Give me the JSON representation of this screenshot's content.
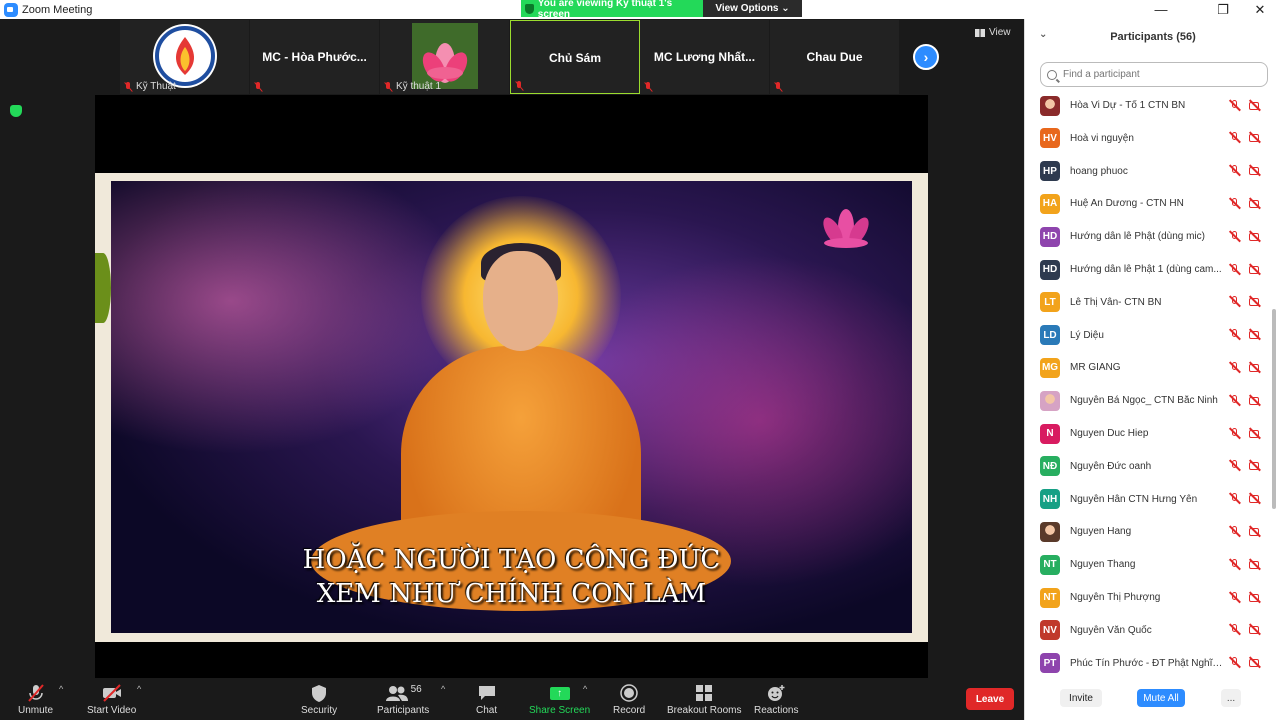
{
  "window": {
    "title": "Zoom Meeting",
    "minimize": "—",
    "maximize": "❐",
    "close": "✕"
  },
  "banner": {
    "viewing": "You are viewing Kỹ thuật 1's screen",
    "view_options": "View Options ⌄"
  },
  "view_label": "View",
  "strip": [
    {
      "name": "",
      "label": "Kỹ Thuật",
      "has_image": "logo"
    },
    {
      "name": "MC - Hòa Phước...",
      "label": ""
    },
    {
      "name": "",
      "label": "Kỹ thuật 1",
      "has_image": "lotus"
    },
    {
      "name": "Chủ Sám",
      "label": "",
      "active": true
    },
    {
      "name": "MC Lương Nhất...",
      "label": ""
    },
    {
      "name": "Chau Due",
      "label": ""
    }
  ],
  "next_arrow": "›",
  "shared_screen": {
    "caption_line1": "HOẶC NGƯỜI TẠO CÔNG ĐỨC",
    "caption_line2": "XEM NHƯ CHÍNH CON LÀM"
  },
  "toolbar": {
    "unmute": "Unmute",
    "start_video": "Start Video",
    "security": "Security",
    "participants": "Participants",
    "participants_count": "56",
    "chat": "Chat",
    "share_screen": "Share Screen",
    "record": "Record",
    "breakout_rooms": "Breakout Rooms",
    "reactions": "Reactions",
    "leave": "Leave",
    "caret": "^"
  },
  "panel": {
    "title": "Participants (56)",
    "collapse": "⌄",
    "search_placeholder": "Find a participant",
    "participants": [
      {
        "initials": "",
        "name": "Hòa Vi Dự - Tổ 1 CTN BN",
        "color": "#8a2a2a",
        "photo": true
      },
      {
        "initials": "HV",
        "name": "Hoà vi nguyện",
        "color": "#e8671c"
      },
      {
        "initials": "HP",
        "name": "hoang phuoc",
        "color": "#2e3a4f"
      },
      {
        "initials": "HA",
        "name": "Huệ An Dương - CTN HN",
        "color": "#f2a31b"
      },
      {
        "initials": "HD",
        "name": "Hướng dẫn lễ Phật (dùng mic)",
        "color": "#8e44ad"
      },
      {
        "initials": "HD",
        "name": "Hướng dẫn lễ Phật 1 (dùng cam...",
        "color": "#2e3a4f"
      },
      {
        "initials": "LT",
        "name": "Lê Thị Vân- CTN BN",
        "color": "#f2a31b"
      },
      {
        "initials": "LD",
        "name": "Lý Diệu",
        "color": "#2a7ab8"
      },
      {
        "initials": "MG",
        "name": "MR GIANG",
        "color": "#f2a31b"
      },
      {
        "initials": "",
        "name": "Nguyễn Bá Ngọc_ CTN Bắc Ninh",
        "color": "#d6a3c4",
        "photo": true
      },
      {
        "initials": "N",
        "name": "Nguyen Duc Hiep",
        "color": "#d81b60"
      },
      {
        "initials": "NĐ",
        "name": "Nguyễn Đức oanh",
        "color": "#27ae60"
      },
      {
        "initials": "NH",
        "name": "Nguyễn Hân CTN Hưng Yên",
        "color": "#16a085"
      },
      {
        "initials": "",
        "name": "Nguyen Hang",
        "color": "#5a3a2a",
        "photo": true
      },
      {
        "initials": "NT",
        "name": "Nguyen Thang",
        "color": "#27ae60"
      },
      {
        "initials": "NT",
        "name": "Nguyễn Thị Phượng",
        "color": "#f2a31b"
      },
      {
        "initials": "NV",
        "name": "Nguyễn Văn Quốc",
        "color": "#c0392b"
      },
      {
        "initials": "PT",
        "name": "Phúc Tín Phước - ĐT Phật Nghĩa...",
        "color": "#8e44ad"
      }
    ],
    "invite": "Invite",
    "mute_all": "Mute All",
    "more": "..."
  }
}
